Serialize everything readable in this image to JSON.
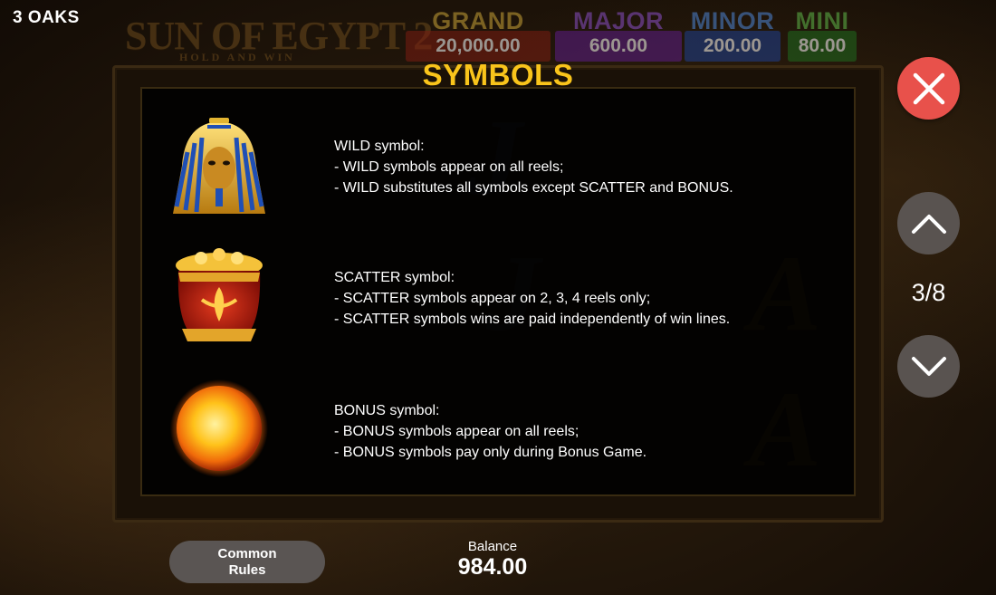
{
  "brand": "3 OAKS",
  "game_logo": {
    "title": "SUN OF EGYPT 2",
    "subtitle": "HOLD AND WIN"
  },
  "jackpots": [
    {
      "name": "GRAND",
      "value": "20,000.00",
      "color": "#c9a437",
      "box": "#7a1d12"
    },
    {
      "name": "MAJOR",
      "value": "600.00",
      "color": "#8a4fc6",
      "box": "#5c1d86"
    },
    {
      "name": "MINOR",
      "value": "200.00",
      "color": "#4d86d6",
      "box": "#1e3f8f"
    },
    {
      "name": "MINI",
      "value": "80.00",
      "color": "#5fb94a",
      "box": "#1f6a1e"
    }
  ],
  "page_title": "SYMBOLS",
  "symbols": [
    {
      "icon": "pharaoh-mask-icon",
      "heading": "WILD symbol:",
      "lines": [
        "- WILD symbols appear on all reels;",
        "- WILD substitutes all symbols except SCATTER and BONUS."
      ]
    },
    {
      "icon": "gold-pot-icon",
      "heading": "SCATTER symbol:",
      "lines": [
        "- SCATTER symbols appear on 2, 3, 4 reels only;",
        "- SCATTER symbols wins are paid independently of win lines."
      ]
    },
    {
      "icon": "sun-icon",
      "heading": "BONUS symbol:",
      "lines": [
        "- BONUS symbols appear on all reels;",
        "- BONUS symbols pay only during Bonus Game."
      ]
    }
  ],
  "pagination": {
    "current": "3/8",
    "up_icon": "chevron-up-icon",
    "down_icon": "chevron-down-icon"
  },
  "close_icon": "close-icon",
  "common_rules": {
    "line1": "Common",
    "line2": "Rules"
  },
  "balance": {
    "label": "Balance",
    "value": "984.00"
  },
  "colors": {
    "title": "#f9c41b",
    "close_button": "#e8514b",
    "nav_button": "#595350",
    "panel": "#000000"
  }
}
